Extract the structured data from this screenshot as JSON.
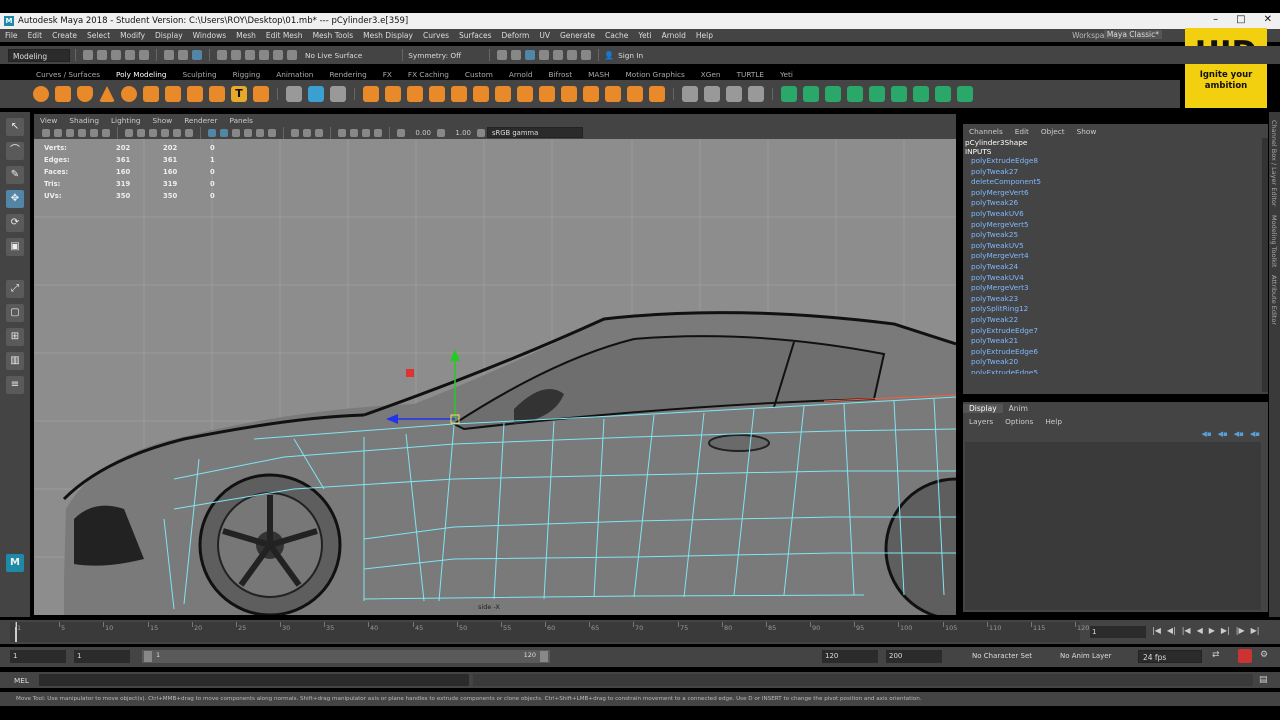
{
  "window": {
    "title": "Autodesk Maya 2018 - Student Version: C:\\Users\\ROY\\Desktop\\01.mb*   ---   pCylinder3.e[359]",
    "controls": [
      "–",
      "□",
      "✕"
    ]
  },
  "menubar": {
    "items": [
      "File",
      "Edit",
      "Create",
      "Select",
      "Modify",
      "Display",
      "Windows",
      "Mesh",
      "Edit Mesh",
      "Mesh Tools",
      "Mesh Display",
      "Curves",
      "Surfaces",
      "Deform",
      "UV",
      "Generate",
      "Cache",
      "Yeti",
      "Arnold",
      "Help"
    ],
    "workspace_label": "Workspace :",
    "workspace_value": "Maya Classic*"
  },
  "statusline": {
    "mode": "Modeling",
    "live_surface": "No Live Surface",
    "symmetry": "Symmetry: Off",
    "sign_in": "Sign In"
  },
  "shelf": {
    "tabs": [
      "Curves / Surfaces",
      "Poly Modeling",
      "Sculpting",
      "Rigging",
      "Animation",
      "Rendering",
      "FX",
      "FX Caching",
      "Custom",
      "Arnold",
      "Bifrost",
      "MASH",
      "Motion Graphics",
      "XGen",
      "TURTLE",
      "Yeti"
    ],
    "active_tab": "Poly Modeling"
  },
  "logo": {
    "big": "UID",
    "tagline_1": "Ignite your",
    "tagline_2": "ambition"
  },
  "viewport": {
    "menu": [
      "View",
      "Shading",
      "Lighting",
      "Show",
      "Renderer",
      "Panels"
    ],
    "exposure": "0.00",
    "gamma": "1.00",
    "color_space": "sRGB gamma",
    "camera_label": "side -X",
    "hud": [
      {
        "label": "Verts:",
        "v1": "202",
        "v2": "202",
        "v3": "0"
      },
      {
        "label": "Edges:",
        "v1": "361",
        "v2": "361",
        "v3": "1"
      },
      {
        "label": "Faces:",
        "v1": "160",
        "v2": "160",
        "v3": "0"
      },
      {
        "label": "Tris:",
        "v1": "319",
        "v2": "319",
        "v3": "0"
      },
      {
        "label": "UVs:",
        "v1": "350",
        "v2": "350",
        "v3": "0"
      }
    ]
  },
  "channelbox": {
    "menu": [
      "Channels",
      "Edit",
      "Object",
      "Show"
    ],
    "node": "pCylinder3Shape",
    "inputs_label": "INPUTS",
    "items": [
      "polyExtrudeEdge8",
      "polyTweak27",
      "deleteComponent5",
      "polyMergeVert6",
      "polyTweak26",
      "polyTweakUV6",
      "polyMergeVert5",
      "polyTweak25",
      "polyTweakUV5",
      "polyMergeVert4",
      "polyTweak24",
      "polyTweakUV4",
      "polyMergeVert3",
      "polyTweak23",
      "polySplitRing12",
      "polyTweak22",
      "polyExtrudeEdge7",
      "polyTweak21",
      "polyExtrudeEdge6",
      "polyTweak20",
      "polyExtrudeEdge5"
    ]
  },
  "layer_editor": {
    "tabs": [
      "Display",
      "Anim"
    ],
    "menu": [
      "Layers",
      "Options",
      "Help"
    ]
  },
  "side_tabs": [
    "Channel Box / Layer Editor",
    "Modeling Toolkit",
    "Attribute Editor"
  ],
  "timeslider": {
    "ticks": [
      "1",
      "5",
      "10",
      "15",
      "20",
      "25",
      "30",
      "35",
      "40",
      "45",
      "50",
      "55",
      "60",
      "65",
      "70",
      "75",
      "80",
      "85",
      "90",
      "95",
      "100",
      "105",
      "110",
      "115",
      "120"
    ],
    "current_frame": "1",
    "playback": [
      "|◀",
      "◀|",
      "|◀",
      "◀",
      "▶",
      "▶|",
      "|▶",
      "▶|"
    ]
  },
  "rangeslider": {
    "start": "1",
    "playback_start": "1",
    "range_start_label": "1",
    "range_end_label": "120",
    "playback_end": "120",
    "end": "200",
    "character_set": "No Character Set",
    "anim_layer": "No Anim Layer",
    "fps": "24 fps"
  },
  "cmdline": {
    "label": "MEL"
  },
  "helpline": {
    "text": "Move Tool: Use manipulator to move object(s). Ctrl+MMB+drag to move components along normals. Shift+drag manipulator axis or plane handles to extrude components or clone objects. Ctrl+Shift+LMB+drag to constrain movement to a connected edge. Use D or INSERT to change the pivot position and axis orientation."
  },
  "colors": {
    "selection_blue": "#7fb8ff",
    "wire_cyan": "#7fe6f2",
    "logo_yellow": "#f2cf0f",
    "manip_green": "#22cc22",
    "manip_blue": "#2233ee",
    "manip_red": "#dd3333"
  }
}
